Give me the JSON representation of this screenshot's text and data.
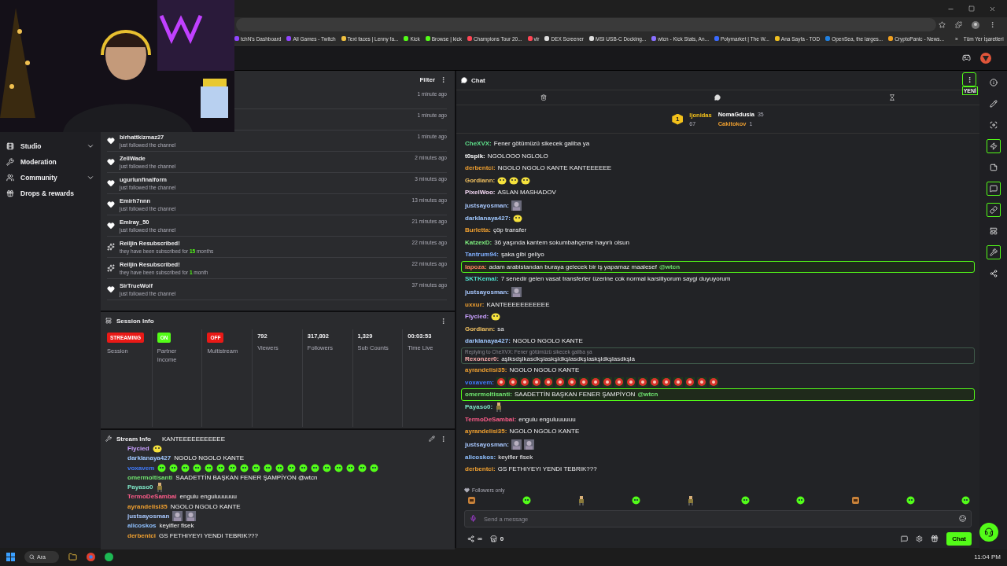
{
  "browser": {
    "bookmarks": [
      "tchN's Dashboard",
      "All Games - Twitch",
      "Text faces | Lenny fa...",
      "Kick",
      "Browse | kick",
      "Champions Tour 20...",
      "vlr",
      "DEX Screener",
      "MSI USB-C Docking...",
      "wtcn - Kick Stats, An...",
      "Polymarket | The W...",
      "Ana Sayfa - TOD",
      "OpenSea, the larges...",
      "CryptoPanic - News..."
    ],
    "more": "»",
    "all_bookmarks": "Tüm Yer İşaretleri"
  },
  "sidebar": {
    "items": [
      {
        "kind": "studio",
        "label": "Studio",
        "expandable": true
      },
      {
        "kind": "moderation",
        "label": "Moderation",
        "expandable": false
      },
      {
        "kind": "community",
        "label": "Community",
        "expandable": true
      },
      {
        "kind": "drops",
        "label": "Drops & rewards",
        "expandable": false
      }
    ]
  },
  "activity": {
    "filter": "Filter",
    "items": [
      {
        "time": "1 minute ago"
      },
      {
        "time": "1 minute ago"
      },
      {
        "kind": "follow",
        "name": "birhattkizmaz27",
        "detail": "just followed the channel",
        "time": "1 minute ago"
      },
      {
        "kind": "follow",
        "name": "ZellWade",
        "detail": "just followed the channel",
        "time": "2 minutes ago"
      },
      {
        "kind": "follow",
        "name": "ugurlunfinalform",
        "detail": "just followed the channel",
        "time": "3 minutes ago"
      },
      {
        "kind": "follow",
        "name": "Emirh7nnn",
        "detail": "just followed the channel",
        "time": "13 minutes ago"
      },
      {
        "kind": "follow",
        "name": "Emiray_50",
        "detail": "just followed the channel",
        "time": "21 minutes ago"
      },
      {
        "kind": "resub",
        "name": "Reiljin Resubscribed!",
        "detail": "they have been subscribed for **15** months",
        "time": "22 minutes ago"
      },
      {
        "kind": "resub",
        "name": "Reiljin Resubscribed!",
        "detail": "they have been subscribed for **1** month",
        "time": "22 minutes ago"
      },
      {
        "kind": "follow",
        "name": "SirTrueWolf",
        "detail": "just followed the channel",
        "time": "37 minutes ago"
      }
    ]
  },
  "session": {
    "title": "Session Info",
    "stats": [
      {
        "kind": "badge",
        "value": "STREAMING",
        "color": "#e91916",
        "label": "Session"
      },
      {
        "kind": "badge",
        "value": "ON",
        "color": "#53fc18",
        "label": "Partner Income"
      },
      {
        "kind": "badge",
        "value": "OFF",
        "color": "#e91916",
        "label": "Multistream"
      },
      {
        "kind": "number",
        "value": "792",
        "label": "Viewers"
      },
      {
        "kind": "number",
        "value": "317,802",
        "label": "Followers"
      },
      {
        "kind": "number",
        "value": "1,329",
        "label": "Sub Counts"
      },
      {
        "kind": "number",
        "value": "00:03:53",
        "label": "Time Live"
      }
    ]
  },
  "stream_info": {
    "title": "Stream Info",
    "overlay": [
      {
        "text": "KANTEEEEEEEEEEE"
      },
      {
        "user": "Flycied",
        "color": "#c9a0ff",
        "emotes": [
          {
            "kind": "smiley"
          }
        ]
      },
      {
        "user": "darklanaya427",
        "color": "#a0c8ff",
        "text": "NGOLO NGOLO KANTE"
      },
      {
        "user": "voxavem",
        "color": "#3f7bff",
        "emotes": [
          {
            "kind": "green"
          },
          {
            "kind": "green"
          },
          {
            "kind": "green"
          },
          {
            "kind": "green"
          },
          {
            "kind": "green"
          },
          {
            "kind": "green"
          },
          {
            "kind": "green"
          },
          {
            "kind": "green"
          },
          {
            "kind": "green"
          },
          {
            "kind": "green"
          },
          {
            "kind": "green"
          },
          {
            "kind": "green"
          },
          {
            "kind": "green"
          },
          {
            "kind": "green"
          },
          {
            "kind": "green"
          },
          {
            "kind": "green"
          },
          {
            "kind": "green"
          },
          {
            "kind": "green"
          },
          {
            "kind": "green"
          }
        ]
      },
      {
        "user": "omermoltisanti",
        "color": "#6fe36f",
        "text": "SAADETTİN BAŞKAN FENER ŞAMPİYON @wtcn"
      },
      {
        "user": "Payaso0",
        "color": "#7fe8c8",
        "emotes": [
          {
            "kind": "pixel"
          }
        ]
      },
      {
        "user": "TermoDeSambai",
        "color": "#ff5c8a",
        "text": "engulu enguluuuuuu"
      },
      {
        "user": "ayrandelisi35",
        "color": "#f0a030",
        "text": "NGOLO NGOLO KANTE"
      },
      {
        "user": "justsayosman",
        "color": "#a8c8ff",
        "emotes": [
          {
            "kind": "figure"
          },
          {
            "kind": "figure"
          }
        ]
      },
      {
        "user": "alicoskos",
        "color": "#8fc0ff",
        "text": "keyifler fisek"
      },
      {
        "user": "derbentci",
        "color": "#f0a030",
        "text": "GS FETHIYEYI YENDI TEBRIK???"
      }
    ]
  },
  "chat": {
    "title": "Chat",
    "new_label": "YENİ",
    "leaderboard": {
      "top": {
        "rank": "1",
        "name": "ljonidas",
        "count": "67"
      },
      "others": [
        {
          "name": "NomaGdusia",
          "count": "35"
        },
        {
          "name": "Cakitokov",
          "count": "1"
        }
      ]
    },
    "messages": [
      {
        "kind": "message",
        "user": "CheXVX:",
        "color": "#5ee08a",
        "text": "Fener götümüzü sikecek galiba ya"
      },
      {
        "kind": "message",
        "user": "t0spik:",
        "color": "#ffffff",
        "text": "NGOLOOO NGLOLO"
      },
      {
        "kind": "message",
        "user": "derbentci:",
        "color": "#f0a030",
        "text": "NGOLO NGOLO KANTE KANTEEEEEE"
      },
      {
        "kind": "message",
        "user": "Gordiann:",
        "color": "#f0c060",
        "emotes": [
          {
            "kind": "smiley"
          },
          {
            "kind": "smiley"
          },
          {
            "kind": "smiley"
          }
        ]
      },
      {
        "kind": "message",
        "user": "PixelWoo:",
        "color": "#f4d8f4",
        "text": "ASLAN MASHADOV"
      },
      {
        "kind": "message",
        "user": "justsayosman:",
        "color": "#a8c8ff",
        "emotes": [
          {
            "kind": "figure"
          }
        ]
      },
      {
        "kind": "message",
        "user": "darklanaya427:",
        "color": "#a0c8ff",
        "emotes": [
          {
            "kind": "smiley"
          }
        ]
      },
      {
        "kind": "message",
        "user": "Burletta:",
        "color": "#f0a030",
        "text": "çöp transfer"
      },
      {
        "kind": "message",
        "user": "KatzexD:",
        "color": "#7ff07f",
        "text": "36 yaşında kantem sokumbahçeme hayırlı olsun"
      },
      {
        "kind": "message",
        "user": "Tantrum94:",
        "color": "#80b0ff",
        "text": "şaka gibi geliyo"
      },
      {
        "kind": "highlighted",
        "user": "lapoza:",
        "color": "#ff8060",
        "text": "adam arabistandan buraya gelecek bir iş yapamaz maalesef",
        "mention": "@wtcn"
      },
      {
        "kind": "message",
        "user": "SKTKemal:",
        "color": "#50e0d0",
        "text": "7 senedir gelen vasat transferler üzerine cok normal karsiliyorum saygi duyuyorum"
      },
      {
        "kind": "message",
        "user": "justsayosman:",
        "color": "#a8c8ff",
        "emotes": [
          {
            "kind": "figure"
          }
        ]
      },
      {
        "kind": "message",
        "user": "uxxur:",
        "color": "#f0a030",
        "text": "KANTEEEEEEEEEEE"
      },
      {
        "kind": "message",
        "user": "Flycied:",
        "color": "#c9a0ff",
        "emotes": [
          {
            "kind": "smiley"
          }
        ]
      },
      {
        "kind": "message",
        "user": "Gordiann:",
        "color": "#f0c060",
        "text": "sa"
      },
      {
        "kind": "message",
        "user": "darklanaya427:",
        "color": "#a0c8ff",
        "text": "NGOLO NGOLO KANTE"
      },
      {
        "kind": "reply",
        "reply_to": "Replying to CheXVX: Fener götümüzü sikecek galiba ya",
        "user": "Rexonzer0:",
        "color": "#ffb0b0",
        "text": "aşlksdşlkasdkşlaskşldkşlasdkşlaskşldkşlasdkşla"
      },
      {
        "kind": "message",
        "user": "ayrandelisi35:",
        "color": "#f0a030",
        "text": "NGOLO NGOLO KANTE"
      },
      {
        "kind": "message",
        "user": "voxavem:",
        "color": "#3f7bff",
        "emotes": [
          {
            "kind": "ball"
          },
          {
            "kind": "ball"
          },
          {
            "kind": "ball"
          },
          {
            "kind": "ball"
          },
          {
            "kind": "ball"
          },
          {
            "kind": "ball"
          },
          {
            "kind": "ball"
          },
          {
            "kind": "ball"
          },
          {
            "kind": "ball"
          },
          {
            "kind": "ball"
          },
          {
            "kind": "ball"
          },
          {
            "kind": "ball"
          },
          {
            "kind": "ball"
          },
          {
            "kind": "ball"
          },
          {
            "kind": "ball"
          },
          {
            "kind": "ball"
          },
          {
            "kind": "ball"
          },
          {
            "kind": "ball"
          },
          {
            "kind": "ball"
          }
        ]
      },
      {
        "kind": "highlighted",
        "user": "omermoltisanti:",
        "color": "#6fe36f",
        "text": "SAADETTİN BAŞKAN FENER ŞAMPİYON",
        "mention": "@wtcn"
      },
      {
        "kind": "message",
        "user": "Payaso0:",
        "color": "#7fe8c8",
        "emotes": [
          {
            "kind": "pixel"
          }
        ]
      },
      {
        "kind": "message",
        "user": "TermoDeSambai:",
        "color": "#ff5c8a",
        "text": "engulu enguluuuuuu"
      },
      {
        "kind": "message",
        "user": "ayrandelisi35:",
        "color": "#f0a030",
        "text": "NGOLO NGOLO KANTE"
      },
      {
        "kind": "message",
        "user": "justsayosman:",
        "color": "#a8c8ff",
        "emotes": [
          {
            "kind": "figure"
          },
          {
            "kind": "figure"
          }
        ]
      },
      {
        "kind": "message",
        "user": "alicoskos:",
        "color": "#8fc0ff",
        "text": "keyifler fisek"
      },
      {
        "kind": "message",
        "user": "derbentci:",
        "color": "#f0a030",
        "text": "GS FETHIYEYI YENDI TEBRIK???"
      }
    ],
    "mode": "Followers only",
    "emote_bar": [
      {
        "kind": "box"
      },
      {
        "kind": "green"
      },
      {
        "kind": "pixel"
      },
      {
        "kind": "green"
      },
      {
        "kind": "pixel"
      },
      {
        "kind": "green"
      },
      {
        "kind": "green"
      },
      {
        "kind": "box"
      },
      {
        "kind": "green"
      },
      {
        "kind": "green"
      }
    ],
    "input": {
      "placeholder": "Send a message"
    },
    "footer": {
      "points": "∞",
      "store": "0",
      "button": "Chat"
    }
  },
  "rail": [
    {
      "kind": "info",
      "active": false
    },
    {
      "kind": "pencil",
      "active": false
    },
    {
      "kind": "focus",
      "active": false
    },
    {
      "kind": "zap",
      "active": true
    },
    {
      "kind": "note",
      "active": false
    },
    {
      "kind": "chat",
      "active": true
    },
    {
      "kind": "link",
      "active": true
    },
    {
      "kind": "layout",
      "active": false
    },
    {
      "kind": "wrench",
      "active": true
    },
    {
      "kind": "share",
      "active": false
    }
  ],
  "taskbar": {
    "search": "Ara",
    "time": "11:04 PM"
  }
}
